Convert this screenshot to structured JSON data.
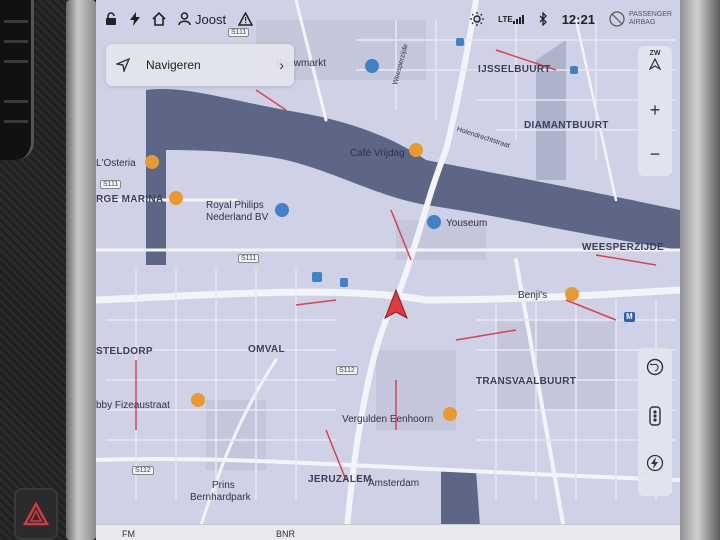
{
  "status_bar": {
    "user": "Joost",
    "network": "LTE",
    "time": "12:21",
    "airbag_line1": "PASSENGER",
    "airbag_line2": "AIRBAG"
  },
  "nav_card": {
    "label": "Navigeren"
  },
  "compass": {
    "heading": "ZW"
  },
  "map_labels": {
    "bouwmarkt": "Bouwmarkt",
    "ijsselbuurt": "IJSSELBUURT",
    "diamantbuurt": "DIAMANTBUURT",
    "cafe_vrijdag": "Café Vrijdag",
    "losteria": "L'Osteria",
    "marina": "RGE MARINA",
    "philips_1": "Royal Philips",
    "philips_2": "Nederland BV",
    "youseum": "Youseum",
    "weesperzijde": "WEESPERZIJDE",
    "benjis": "Benji's",
    "steldorp": "STELDORP",
    "omval": "OMVAL",
    "transvaalbuurt": "TRANSVAALBUURT",
    "fizeaustraat": "bby Fizeaustraat",
    "vergulden": "Vergulden Eenhoorn",
    "prins_1": "Prins",
    "prins_2": "Bernhardpark",
    "jeruzalem": "JERUZALEM",
    "amsterdam": "Amsterdam",
    "road_s111": "S111",
    "road_s112": "S112",
    "street_weesper": "Weesperzijde",
    "street_hol": "Holendrechtstraat",
    "station_m": "M"
  },
  "bottom_bar": {
    "left": "FM",
    "right": "BNR"
  },
  "colors": {
    "land": "#cfd2e6",
    "water": "#5d6687",
    "road": "#f3f4f8",
    "traffic": "#d8434b",
    "poi_orange": "#e89a2f",
    "poi_blue": "#3e82c7",
    "vehicle": "#e03a3a"
  }
}
